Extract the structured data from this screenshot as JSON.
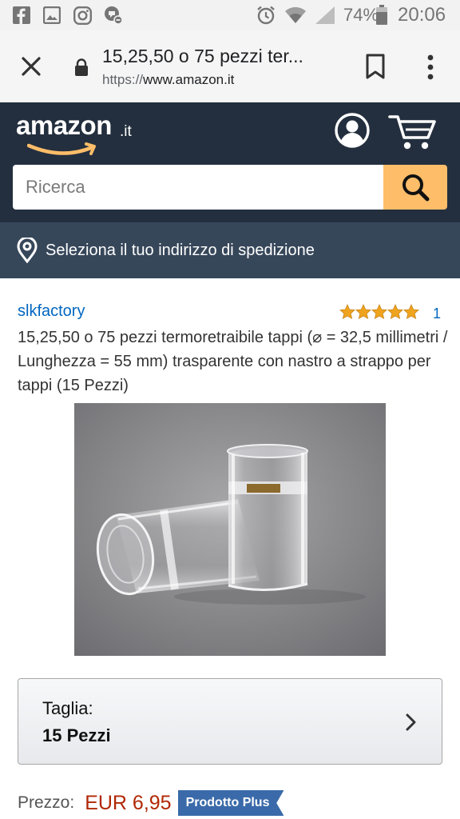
{
  "status_bar": {
    "battery": "74%",
    "time": "20:06",
    "icons": [
      "facebook-icon",
      "gallery-icon",
      "instagram-icon",
      "blocked-notification-icon",
      "alarm-icon",
      "wifi-icon",
      "signal-icon",
      "battery-icon"
    ]
  },
  "browser": {
    "title": "15,25,50 o 75 pezzi ter...",
    "url_scheme": "https://",
    "url_host": "www.amazon.it"
  },
  "header": {
    "logo_word": "amazon",
    "logo_tld": ".it",
    "search_placeholder": "Ricerca",
    "accent_color": "#febd69",
    "background_color": "#232f3e"
  },
  "delivery": {
    "label": "Seleziona il tuo indirizzo di spedizione"
  },
  "product": {
    "brand": "slkfactory",
    "rating_stars": 5,
    "review_count": "1",
    "title": "15,25,50 o 75 pezzi termoretraibile tappi (⌀ = 32,5 millimetri / Lunghezza = 55 mm) trasparente con nastro a strappo per tappi (15 Pezzi)",
    "size_label": "Taglia:",
    "size_value": "15 Pezzi",
    "price_label": "Prezzo:",
    "price_value": "EUR 6,95",
    "badge": "Prodotto Plus",
    "price_color": "#b12704"
  }
}
